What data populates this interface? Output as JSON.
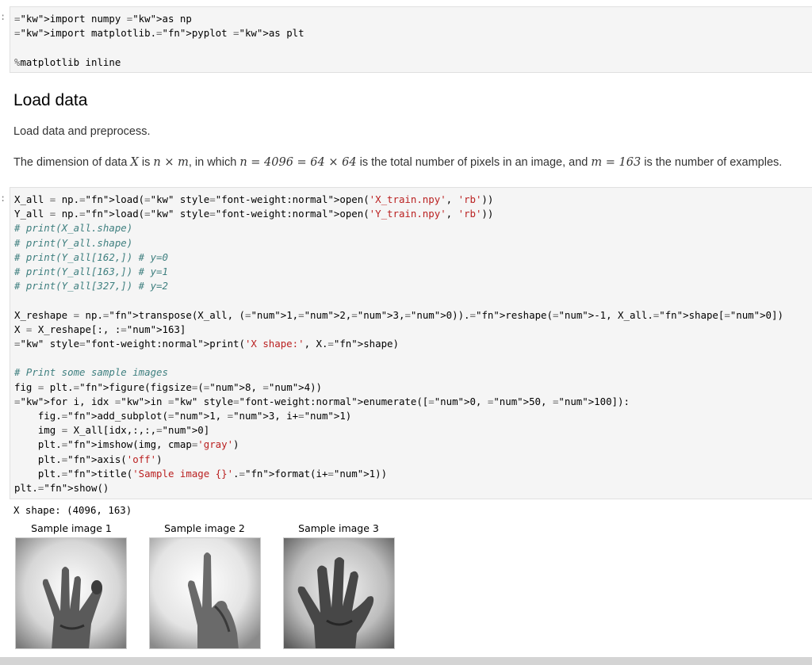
{
  "cell1": {
    "prompt": ":",
    "lines": [
      "import numpy as np",
      "import matplotlib.pyplot as plt",
      "",
      "%matplotlib inline"
    ]
  },
  "markdown": {
    "heading": "Load data",
    "para1": "Load data and preprocess.",
    "para2_a": "The dimension of data ",
    "para2_X": "X",
    "para2_b": " is ",
    "para2_nxm": "n × m",
    "para2_c": ", in which ",
    "para2_eq1": "n = 4096 = 64 × 64",
    "para2_d": " is the total number of pixels in an image, and ",
    "para2_eq2": "m = 163",
    "para2_e": " is the number of examples."
  },
  "cell2": {
    "prompt": ":",
    "code_lines": [
      "X_all = np.load(open('X_train.npy', 'rb'))",
      "Y_all = np.load(open('Y_train.npy', 'rb'))",
      "# print(X_all.shape)",
      "# print(Y_all.shape)",
      "# print(Y_all[162,]) # y=0",
      "# print(Y_all[163,]) # y=1",
      "# print(Y_all[327,]) # y=2",
      "",
      "X_reshape = np.transpose(X_all, (1,2,3,0)).reshape(-1, X_all.shape[0])",
      "X = X_reshape[:, :163]",
      "print('X shape:', X.shape)",
      "",
      "# Print some sample images",
      "fig = plt.figure(figsize=(8, 4))",
      "for i, idx in enumerate([0, 50, 100]):",
      "    fig.add_subplot(1, 3, i+1)",
      "    img = X_all[idx,:,:,0]",
      "    plt.imshow(img, cmap='gray')",
      "    plt.axis('off')",
      "    plt.title('Sample image {}'.format(i+1))",
      "plt.show()"
    ]
  },
  "output": {
    "stdout": "X shape: (4096, 163)",
    "figures": [
      {
        "title": "Sample image 1",
        "depicts": "hand-sign-3-ok"
      },
      {
        "title": "Sample image 2",
        "depicts": "hand-sign-2"
      },
      {
        "title": "Sample image 3",
        "depicts": "hand-sign-3-ok"
      }
    ]
  }
}
